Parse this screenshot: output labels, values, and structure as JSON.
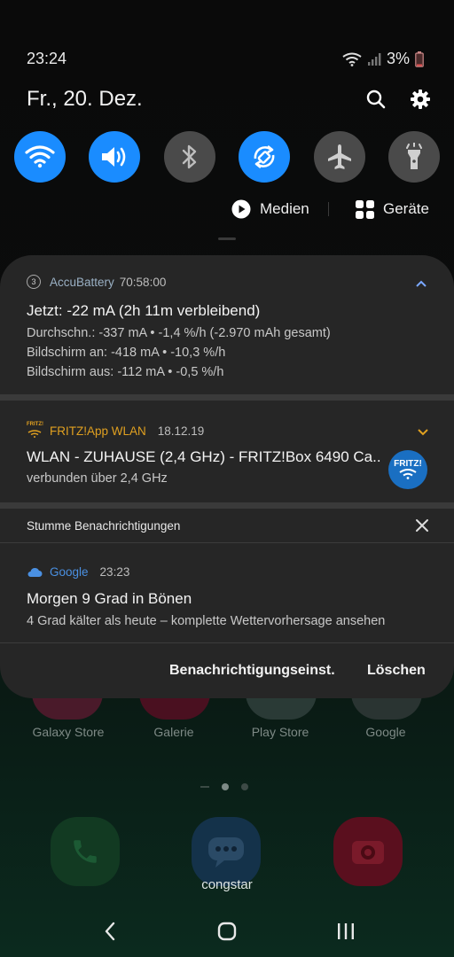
{
  "status_bar": {
    "time": "23:24",
    "battery": "3%"
  },
  "header": {
    "date": "Fr., 20. Dez."
  },
  "quick_panel": {
    "toggles": [
      {
        "name": "wifi",
        "on": true
      },
      {
        "name": "sound",
        "on": true
      },
      {
        "name": "bluetooth",
        "on": false
      },
      {
        "name": "auto-rotate",
        "on": true
      },
      {
        "name": "airplane-mode",
        "on": false
      },
      {
        "name": "flashlight",
        "on": false
      }
    ],
    "media_label": "Medien",
    "devices_label": "Geräte"
  },
  "notifications": {
    "accubattery": {
      "app_badge": "3",
      "app": "AccuBattery",
      "time": "70:58:00",
      "title": "Jetzt: -22 mA (2h 11m verbleibend)",
      "lines": [
        "Durchschn.: -337 mA • -1,4 %/h (-2.970 mAh gesamt)",
        "Bildschirm an: -418 mA • -10,3 %/h",
        "Bildschirm aus: -112 mA • -0,5 %/h"
      ]
    },
    "fritz": {
      "app_logo": "FRITZ!",
      "app": "FRITZ!App WLAN",
      "time": "18.12.19",
      "title": "WLAN - ZUHAUSE (2,4 GHz) - FRITZ!Box 6490 Ca..",
      "subtitle": "verbunden über 2,4 GHz",
      "badge_text": "FRITZ!"
    },
    "silent_header": "Stumme Benachrichtigungen",
    "google": {
      "app": "Google",
      "time": "23:23",
      "title": "Morgen 9 Grad in Bönen",
      "subtitle": "4 Grad kälter als heute – komplette Wettervorhersage ansehen"
    },
    "actions": {
      "settings": "Benachrichtigungseinst.",
      "clear": "Löschen"
    }
  },
  "home": {
    "apps": [
      "Galaxy Store",
      "Galerie",
      "Play Store",
      "Google"
    ],
    "dock_label": "congstar"
  },
  "colors": {
    "accent": "#1a8cff",
    "panel": "#262626",
    "fritz_orange": "#e0a020",
    "google_blue": "#4a90e2"
  }
}
